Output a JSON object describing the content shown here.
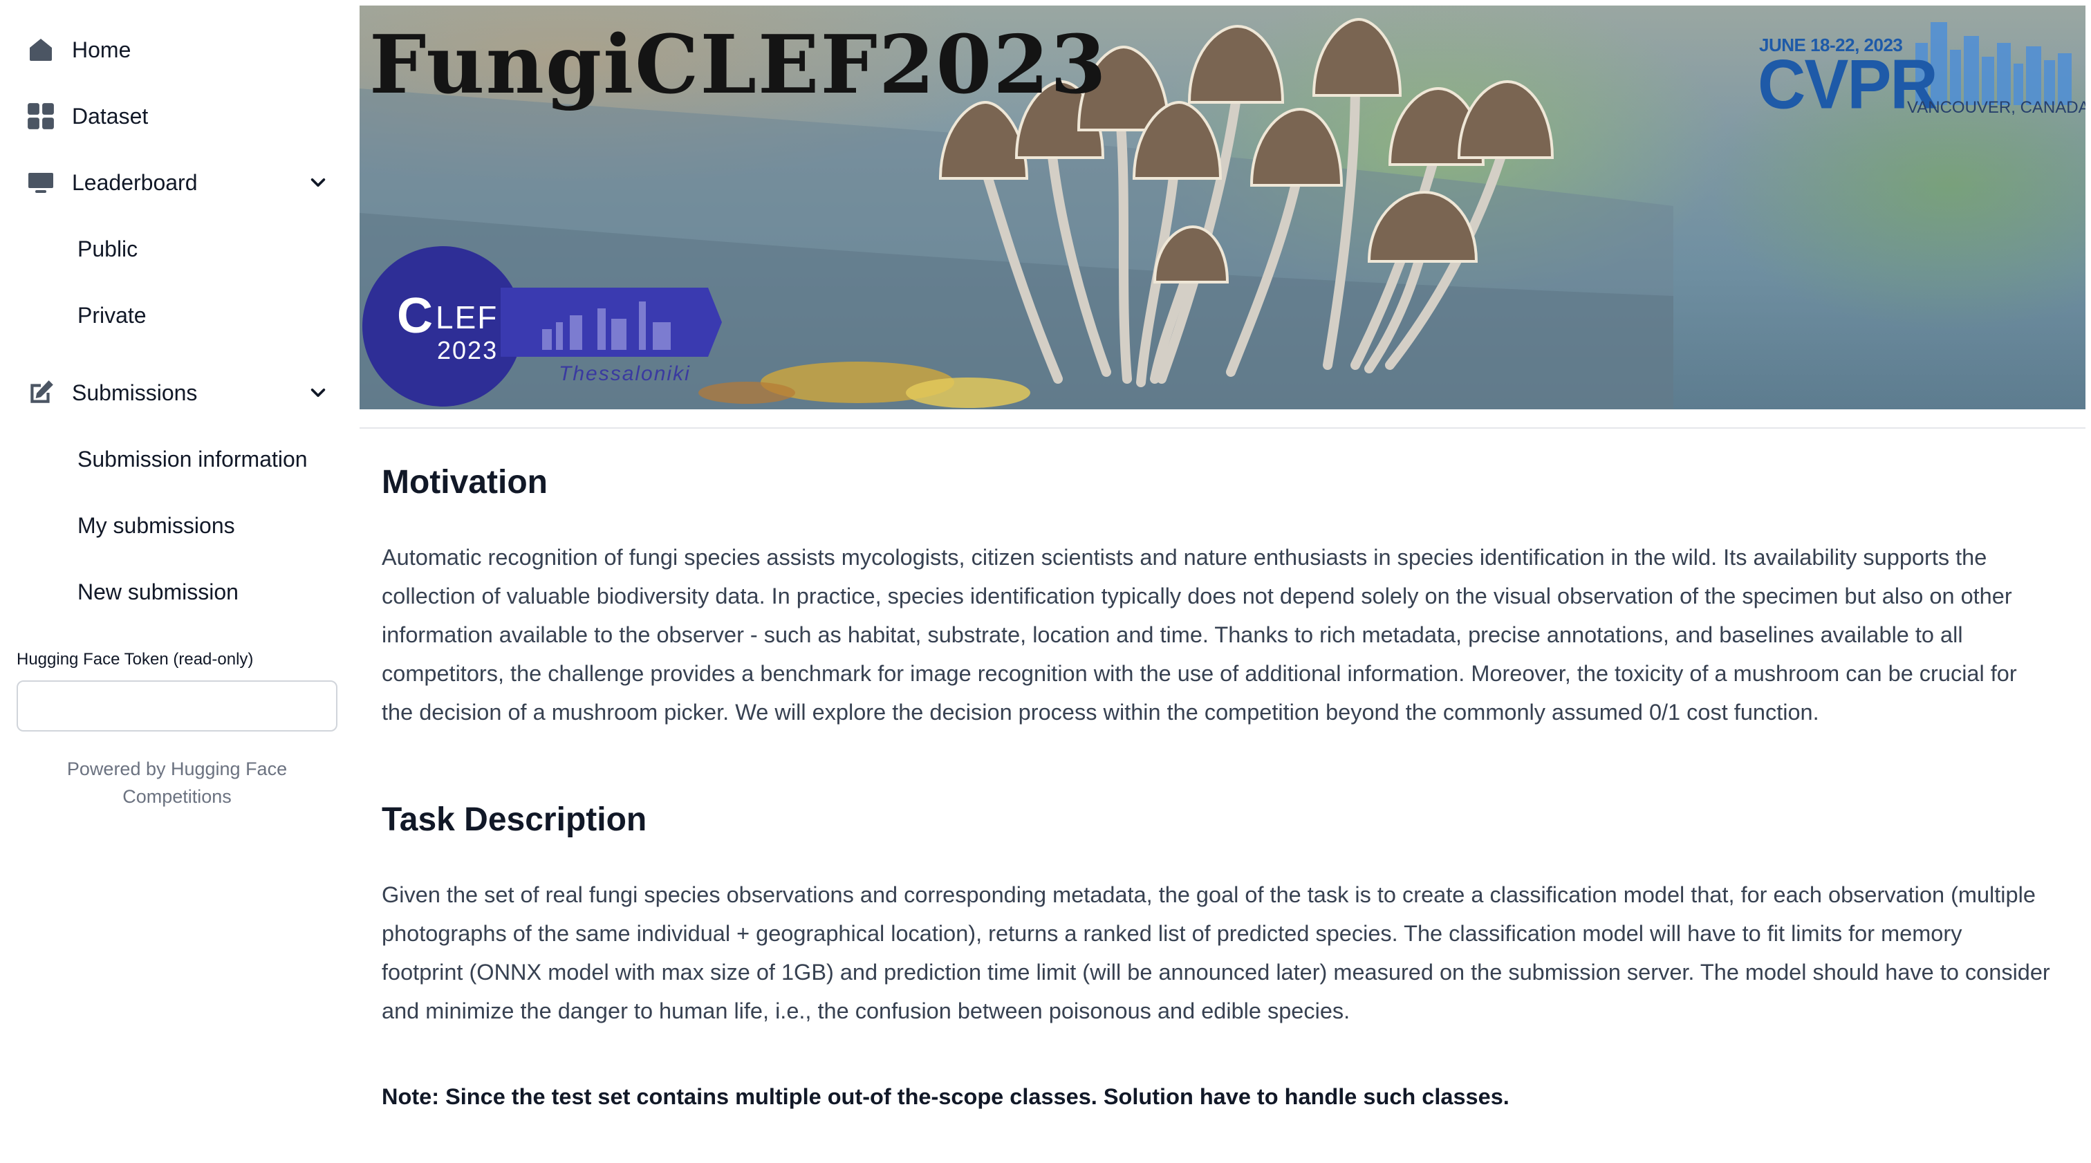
{
  "sidebar": {
    "items": [
      {
        "label": "Home",
        "icon": "home-icon"
      },
      {
        "label": "Dataset",
        "icon": "grid-icon"
      },
      {
        "label": "Leaderboard",
        "icon": "monitor-icon",
        "expanded": true,
        "children": [
          {
            "label": "Public"
          },
          {
            "label": "Private"
          }
        ]
      },
      {
        "label": "Submissions",
        "icon": "edit-icon",
        "expanded": true,
        "children": [
          {
            "label": "Submission information"
          },
          {
            "label": "My submissions"
          },
          {
            "label": "New submission"
          }
        ]
      }
    ],
    "token": {
      "label": "Hugging Face Token (read-only)",
      "value": "",
      "placeholder": ""
    },
    "powered_by": [
      "Powered by Hugging Face",
      "Competitions"
    ]
  },
  "banner": {
    "title": "FungiCLEF2023",
    "clef": {
      "letter": "C",
      "lef": "LEF",
      "year": "2023",
      "city": "Thessaloniki"
    },
    "cvpr": {
      "dates": "JUNE 18-22, 2023",
      "name": "CVPR",
      "city": "VANCOUVER, CANADA"
    }
  },
  "content": {
    "sections": [
      {
        "heading": "Motivation",
        "paragraph_lines": [
          "Automatic recognition of fungi species assists mycologists, citizen scientists and nature enthusiasts in species identification in the wild. Its availability supports the",
          "collection of valuable biodiversity data. In practice, species identification typically does not depend solely on the visual observation of the specimen but also on other",
          "information available to the observer - such as habitat, substrate, location and time. Thanks to rich metadata, precise annotations, and baselines available to all",
          "competitors, the challenge provides a benchmark for image recognition with the use of additional information. Moreover, the toxicity of a mushroom can be crucial for",
          "the decision of a mushroom picker. We will explore the decision process within the competition beyond the commonly assumed 0/1 cost function."
        ]
      },
      {
        "heading": "Task Description",
        "paragraph_lines": [
          "Given the set of real fungi species observations and corresponding metadata, the goal of the task is to create a classification model that, for each observation (multiple",
          "photographs of the same individual + geographical location), returns a ranked list of predicted species. The classification model will have to fit limits for memory",
          "footprint (ONNX model with max size of 1GB) and prediction time limit (will be announced later) measured on the submission server. The model should have to consider",
          "and minimize the danger to human life, i.e., the confusion between poisonous and edible species."
        ],
        "note": "Note: Since the test set contains multiple out-of the-scope classes. Solution have to handle such classes."
      }
    ]
  },
  "colors": {
    "icon": "#4b5563",
    "text": "#111827",
    "body_text": "#374151",
    "muted": "#6b7280",
    "clef_blue": "#2e2e96",
    "cvpr_blue": "#1e5aa8"
  }
}
